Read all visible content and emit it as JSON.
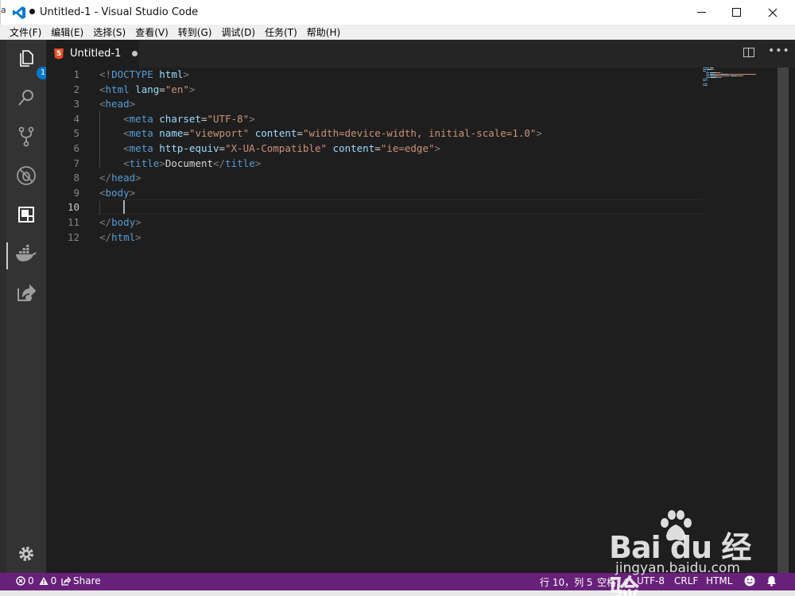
{
  "window": {
    "edge_char": "a",
    "title": "Untitled-1 - Visual Studio Code",
    "dirty": true
  },
  "menu": {
    "items": [
      "文件(F)",
      "编辑(E)",
      "选择(S)",
      "查看(V)",
      "转到(G)",
      "调试(D)",
      "任务(T)",
      "帮助(H)"
    ]
  },
  "activity_bar": {
    "items": [
      {
        "name": "explorer-icon",
        "badge": "1"
      },
      {
        "name": "search-icon"
      },
      {
        "name": "source-control-icon"
      },
      {
        "name": "debug-icon"
      },
      {
        "name": "extensions-icon",
        "active": true
      },
      {
        "name": "docker-icon"
      },
      {
        "name": "live-share-icon"
      }
    ],
    "settings": "gear-icon"
  },
  "tabs": [
    {
      "label": "Untitled-1",
      "language_icon": "html5-icon",
      "icon_text": "5",
      "dirty": true
    }
  ],
  "editor": {
    "current_line": 10,
    "lines": [
      {
        "n": "1",
        "tokens": [
          [
            "p",
            "<!"
          ],
          [
            "t",
            "DOCTYPE"
          ],
          [
            "x",
            " "
          ],
          [
            "a",
            "html"
          ],
          [
            "p",
            ">"
          ]
        ]
      },
      {
        "n": "2",
        "tokens": [
          [
            "p",
            "<"
          ],
          [
            "t",
            "html"
          ],
          [
            "x",
            " "
          ],
          [
            "a",
            "lang"
          ],
          [
            "x",
            "="
          ],
          [
            "s",
            "\"en\""
          ],
          [
            "p",
            ">"
          ]
        ]
      },
      {
        "n": "3",
        "tokens": [
          [
            "p",
            "<"
          ],
          [
            "t",
            "head"
          ],
          [
            "p",
            ">"
          ]
        ]
      },
      {
        "n": "4",
        "tokens": [
          [
            "x",
            "    "
          ],
          [
            "p",
            "<"
          ],
          [
            "t",
            "meta"
          ],
          [
            "x",
            " "
          ],
          [
            "a",
            "charset"
          ],
          [
            "x",
            "="
          ],
          [
            "s",
            "\"UTF-8\""
          ],
          [
            "p",
            ">"
          ]
        ]
      },
      {
        "n": "5",
        "tokens": [
          [
            "x",
            "    "
          ],
          [
            "p",
            "<"
          ],
          [
            "t",
            "meta"
          ],
          [
            "x",
            " "
          ],
          [
            "a",
            "name"
          ],
          [
            "x",
            "="
          ],
          [
            "s",
            "\"viewport\""
          ],
          [
            "x",
            " "
          ],
          [
            "a",
            "content"
          ],
          [
            "x",
            "="
          ],
          [
            "s",
            "\"width=device-width, initial-scale=1.0\""
          ],
          [
            "p",
            ">"
          ]
        ]
      },
      {
        "n": "6",
        "tokens": [
          [
            "x",
            "    "
          ],
          [
            "p",
            "<"
          ],
          [
            "t",
            "meta"
          ],
          [
            "x",
            " "
          ],
          [
            "a",
            "http-equiv"
          ],
          [
            "x",
            "="
          ],
          [
            "s",
            "\"X-UA-Compatible\""
          ],
          [
            "x",
            " "
          ],
          [
            "a",
            "content"
          ],
          [
            "x",
            "="
          ],
          [
            "s",
            "\"ie=edge\""
          ],
          [
            "p",
            ">"
          ]
        ]
      },
      {
        "n": "7",
        "tokens": [
          [
            "x",
            "    "
          ],
          [
            "p",
            "<"
          ],
          [
            "t",
            "title"
          ],
          [
            "p",
            ">"
          ],
          [
            "x",
            "Document"
          ],
          [
            "p",
            "</"
          ],
          [
            "t",
            "title"
          ],
          [
            "p",
            ">"
          ]
        ]
      },
      {
        "n": "8",
        "tokens": [
          [
            "p",
            "</"
          ],
          [
            "t",
            "head"
          ],
          [
            "p",
            ">"
          ]
        ]
      },
      {
        "n": "9",
        "tokens": [
          [
            "p",
            "<"
          ],
          [
            "t",
            "body"
          ],
          [
            "p",
            ">"
          ]
        ]
      },
      {
        "n": "10",
        "tokens": []
      },
      {
        "n": "11",
        "tokens": [
          [
            "p",
            "</"
          ],
          [
            "t",
            "body"
          ],
          [
            "p",
            ">"
          ]
        ]
      },
      {
        "n": "12",
        "tokens": [
          [
            "p",
            "</"
          ],
          [
            "t",
            "html"
          ],
          [
            "p",
            ">"
          ]
        ]
      }
    ]
  },
  "status_bar": {
    "errors": "0",
    "warnings": "0",
    "share": "Share",
    "position": "行 10，列 5",
    "spaces": "空格: 4",
    "encoding": "UTF-8",
    "eol": "CRLF",
    "language": "HTML",
    "color": "#68217a"
  },
  "watermark": {
    "logo": "Bai du 经验",
    "url": "jingyan.baidu.com"
  }
}
